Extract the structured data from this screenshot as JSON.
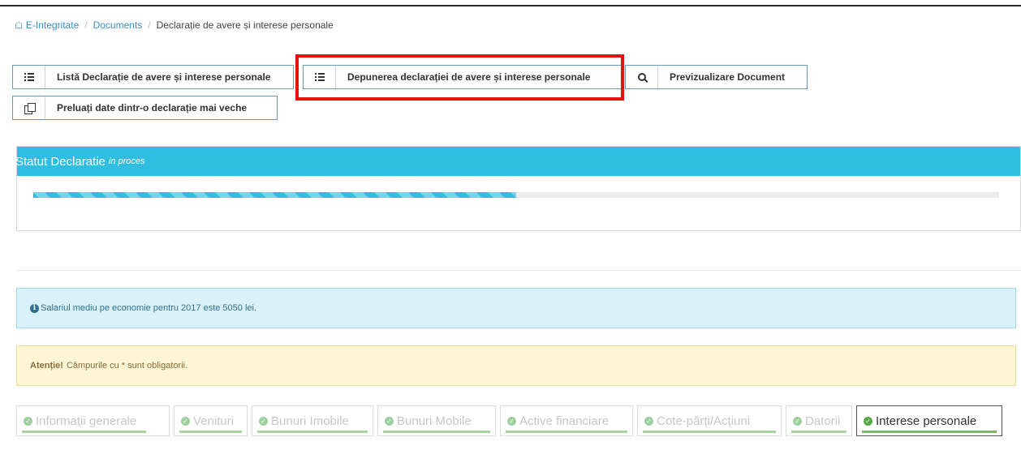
{
  "breadcrumb": {
    "home": "E-Integritate",
    "section": "Documents",
    "current": "Declarație de avere și interese personale"
  },
  "actions": {
    "list": "Listă Declarație de avere și interese personale",
    "submit": "Depunerea declarației de avere și interese personale",
    "preview": "Previzualizare Document",
    "import": "Preluați date dintr-o declarație mai veche"
  },
  "status": {
    "title": "Statut Declaratie",
    "state": "in proces",
    "progress_fraction": 0.5
  },
  "alerts": {
    "info": "Salariul mediu pe economie pentru 2017 este 5050 lei.",
    "warning_bold": "Atenție!",
    "warning_text": "Câmpurile cu * sunt obligatorii."
  },
  "tabs": [
    {
      "label": "Informații generale"
    },
    {
      "label": "Venituri"
    },
    {
      "label": "Bunuri Imobile"
    },
    {
      "label": "Bunuri Mobile"
    },
    {
      "label": "Active financiare"
    },
    {
      "label": "Cote-părți/Acțiuni"
    },
    {
      "label": "Datorii"
    },
    {
      "label": "Interese personale"
    }
  ],
  "colors": {
    "header": "#2fbde0",
    "highlight": "#e8110f",
    "tab_bar": "#a5d59a"
  }
}
